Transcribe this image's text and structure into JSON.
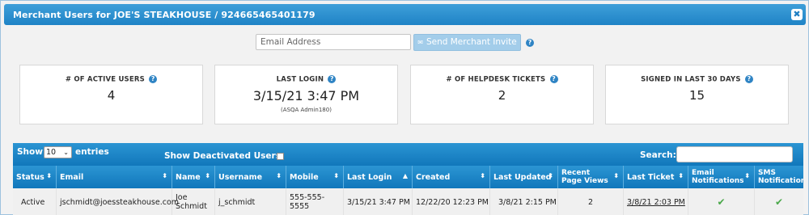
{
  "dialog": {
    "title": "Merchant Users for JOE'S STEAKHOUSE / 924665465401179",
    "close_glyph": "✖"
  },
  "invite": {
    "email_placeholder": "Email Address",
    "email_value": "",
    "button_label": "Send Merchant Invite",
    "help_glyph": "?"
  },
  "stats": [
    {
      "label": "# OF ACTIVE USERS",
      "value": "4",
      "sub": ""
    },
    {
      "label": "LAST LOGIN",
      "value": "3/15/21 3:47 PM",
      "sub": "(ASQA Admin180)"
    },
    {
      "label": "# OF HELPDESK TICKETS",
      "value": "2",
      "sub": ""
    },
    {
      "label": "SIGNED IN LAST 30 DAYS",
      "value": "15",
      "sub": ""
    }
  ],
  "table": {
    "show_label": "Show",
    "entries_value": "10",
    "entries_label": "entries",
    "deactivated_label": "Show Deactivated Users",
    "search_label": "Search:",
    "search_value": "",
    "columns": [
      {
        "label": "Status",
        "sort": "⬍"
      },
      {
        "label": "Email",
        "sort": "⬍"
      },
      {
        "label": "Name",
        "sort": "⬍"
      },
      {
        "label": "Username",
        "sort": "⬍"
      },
      {
        "label": "Mobile",
        "sort": "⬍"
      },
      {
        "label": "Last Login",
        "sort": "▲"
      },
      {
        "label": "Created",
        "sort": "⬍"
      },
      {
        "label": "Last Updated",
        "sort": "⬍"
      },
      {
        "label": "Recent Page Views",
        "sort": "⬍"
      },
      {
        "label": "Last Ticket",
        "sort": "⬍"
      },
      {
        "label": "Email Notifications",
        "sort": "⬍"
      },
      {
        "label": "SMS Notifications",
        "sort": ""
      }
    ],
    "rows": [
      {
        "status": "Active",
        "email": "jschmidt@joessteakhouse.com",
        "name": "Joe Schmidt",
        "username": "j_schmidt",
        "mobile": "555-555-5555",
        "last_login": "3/15/21 3:47 PM",
        "created": "12/22/20 12:23 PM",
        "last_updated": "3/8/21 2:15 PM",
        "recent_page_views": "2",
        "last_ticket": "3/8/21 2:03 PM",
        "email_notifications": "✔",
        "sms_notifications": "✔"
      }
    ]
  },
  "colors": {
    "header_blue": "#1f83c6",
    "button_disabled": "#a3cdea",
    "check_green": "#4aa84a"
  }
}
